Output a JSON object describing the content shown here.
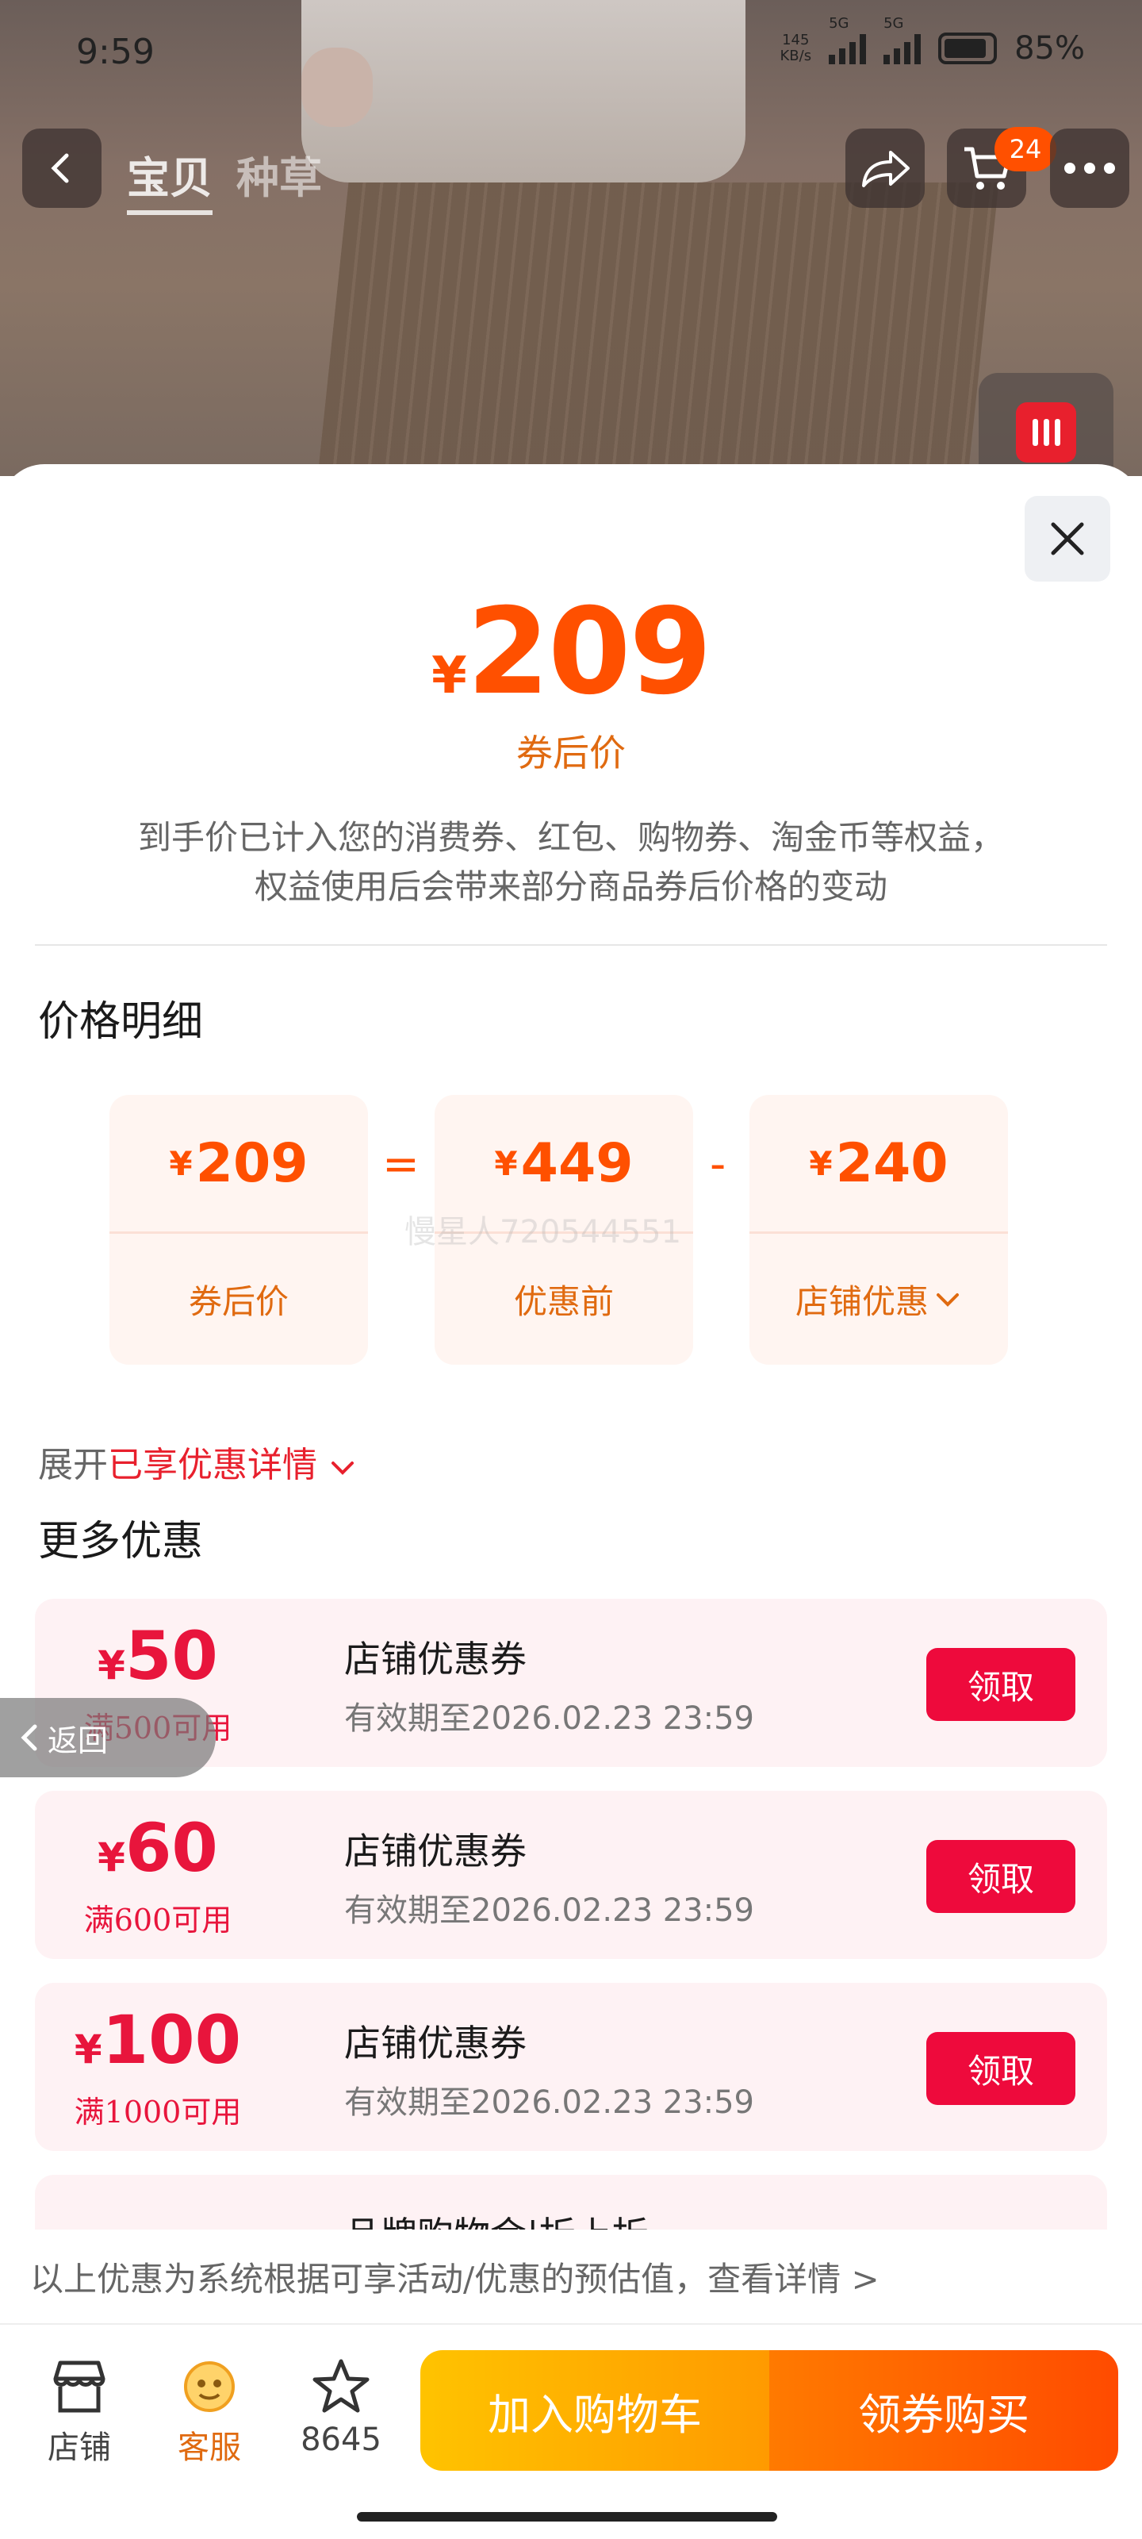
{
  "status_bar": {
    "time": "9:59",
    "net_speed": "145\nKB/s",
    "net1": "5G",
    "net2": "5G",
    "battery": "85%"
  },
  "header": {
    "tabs": [
      "宝贝",
      "种草"
    ],
    "cart_count": "24"
  },
  "sheet": {
    "price_symbol": "¥",
    "price": "209",
    "price_caption": "券后价",
    "note_line1": "到手价已计入您的消费券、红包、购物券、淘金币等权益，",
    "note_line2": "权益使用后会带来部分商品券后价格的变动",
    "detail_title": "价格明细",
    "breakdown": [
      {
        "value": "209",
        "label": "券后价"
      },
      {
        "value": "449",
        "label": "优惠前"
      },
      {
        "value": "240",
        "label": "店铺优惠"
      }
    ],
    "op_equal": "=",
    "op_minus": "-",
    "watermark": "慢星人720544551",
    "expand_prefix": "展开",
    "expand_highlight": "已享优惠详情",
    "more_title": "更多优惠",
    "coupons": [
      {
        "amount": "50",
        "condition": "满500可用",
        "title": "店铺优惠券",
        "expiry": "有效期至2026.02.23 23:59",
        "button": "领取"
      },
      {
        "amount": "60",
        "condition": "满600可用",
        "title": "店铺优惠券",
        "expiry": "有效期至2026.02.23 23:59",
        "button": "领取"
      },
      {
        "amount": "100",
        "condition": "满1000可用",
        "title": "店铺优惠券",
        "expiry": "有效期至2026.02.23 23:59",
        "button": "领取"
      },
      {
        "title": "品牌购物金|折上折"
      }
    ],
    "back_label": "返回",
    "disclaimer": "以上优惠为系统根据可享活动/优惠的预估值，查看详情 >"
  },
  "bottom_bar": {
    "store": "店铺",
    "service": "客服",
    "favorites": "8645",
    "add_cart": "加入购物车",
    "buy": "领券购买"
  },
  "colors": {
    "accent": "#ff5000",
    "coupon_red": "#ee0a3c",
    "cart_yellow": "#ffc300"
  }
}
